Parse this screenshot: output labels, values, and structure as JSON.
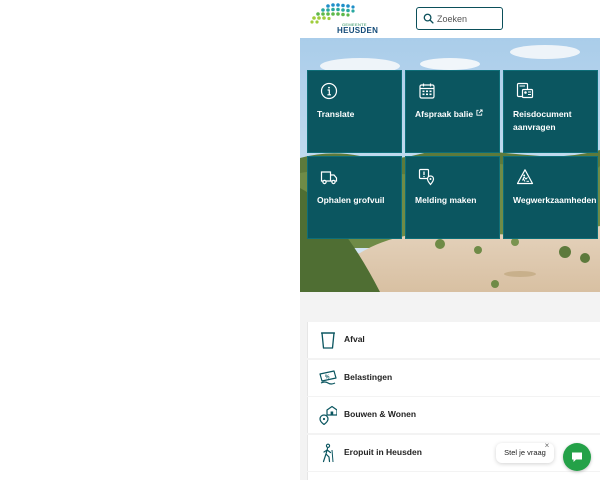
{
  "header": {
    "logo_small": "GEMEENTE",
    "logo_text": "HEUSDEN",
    "search_placeholder": "Zoeken"
  },
  "colors": {
    "tile_bg": "#0b5660",
    "accent_green": "#24a148",
    "logo_blue": "#124a78"
  },
  "tiles": [
    {
      "label": "Translate",
      "icon": "info-icon"
    },
    {
      "label": "Afspraak balie",
      "icon": "calendar-icon",
      "external": true
    },
    {
      "label": "Reisdocument aanvragen",
      "icon": "id-card-icon"
    },
    {
      "label": "Ophalen grofvuil",
      "icon": "truck-icon"
    },
    {
      "label": "Melding maken",
      "icon": "report-pin-icon"
    },
    {
      "label": "Wegwerkzaamheden",
      "icon": "roadwork-icon"
    }
  ],
  "list": [
    {
      "label": "Afval",
      "icon": "bin-icon"
    },
    {
      "label": "Belastingen",
      "icon": "tax-icon"
    },
    {
      "label": "Bouwen & Wonen",
      "icon": "house-pin-icon"
    },
    {
      "label": "Eropuit in Heusden",
      "icon": "hiker-icon"
    }
  ],
  "chat": {
    "prompt": "Stel je vraag",
    "close": "×"
  }
}
